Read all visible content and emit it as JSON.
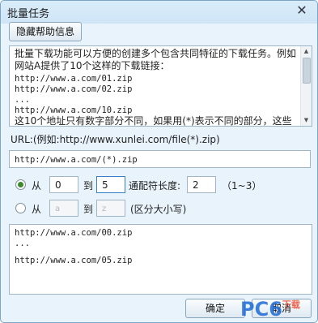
{
  "window": {
    "title": "批量任务"
  },
  "help_button": "隐藏帮助信息",
  "help": {
    "description": "批量下载功能可以方便的创建多个包含共同特征的下载任务。例如网站A提供了10个这样的下载链接：",
    "lines": [
      "http://www.a.com/01.zip",
      "http://www.a.com/02.zip",
      "...",
      "http://www.a.com/10.zip"
    ],
    "footer": "这10个地址只有数字部分不同，如果用(*)表示不同的部分，这些"
  },
  "url_label": "URL:(例如:http://www.xunlei.com/file(*).zip)",
  "url_pattern": "http://www.a.com/(*).zip",
  "numeric_range": {
    "from_label": "从",
    "from": "0",
    "to_label": "到",
    "to": "5",
    "wildcard_label": "通配符长度:",
    "wildcard": "2",
    "hint": "（1~3）",
    "selected": true
  },
  "letter_range": {
    "from_label": "从",
    "from": "a",
    "to_label": "到",
    "to": "z",
    "hint": "(区分大小写)",
    "selected": false
  },
  "output": {
    "lines": [
      "http://www.a.com/00.zip",
      "...",
      "http://www.a.com/05.zip"
    ]
  },
  "buttons": {
    "ok": "确定",
    "cancel": "取消"
  },
  "watermark": {
    "text": "PC6",
    "sub": "下载"
  },
  "colors": {
    "accent": "#3c8b2a",
    "title_bar": "#d9ecf9",
    "border": "#7aa7c9"
  }
}
